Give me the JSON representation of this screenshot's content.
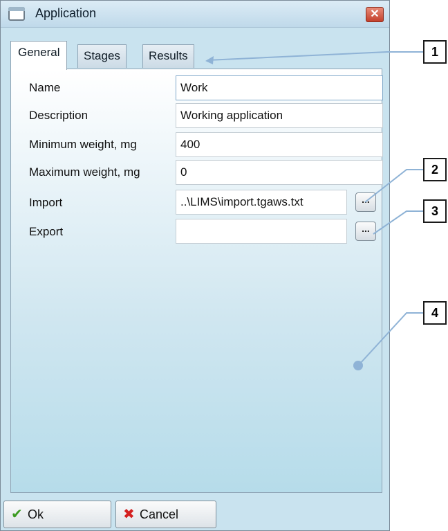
{
  "window": {
    "title": "Application",
    "close_glyph": "✕"
  },
  "tabs": [
    {
      "label": "General"
    },
    {
      "label": "Stages"
    },
    {
      "label": "Results"
    }
  ],
  "form": {
    "name_label": "Name",
    "name_value": "Work",
    "description_label": "Description",
    "description_value": "Working application",
    "min_weight_label": "Minimum weight, mg",
    "min_weight_value": "400",
    "max_weight_label": "Maximum weight, mg",
    "max_weight_value": "0",
    "import_label": "Import",
    "import_value": "..\\LIMS\\import.tgaws.txt",
    "export_label": "Export",
    "export_value": "",
    "browse_glyph": "..."
  },
  "buttons": {
    "ok_label": "Ok",
    "ok_icon": "checkmark-icon",
    "cancel_label": "Cancel",
    "cancel_icon": "cross-icon"
  },
  "callouts": [
    "1",
    "2",
    "3",
    "4"
  ],
  "colors": {
    "panel_bottom": "#b6dcea",
    "callout_line": "#8fb3d6",
    "ok_green": "#3a9a1f",
    "cancel_red": "#d42020"
  }
}
